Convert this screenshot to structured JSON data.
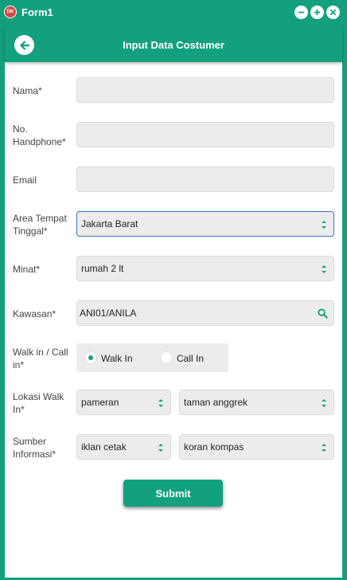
{
  "window": {
    "title": "Form1",
    "icon_text": "DK"
  },
  "header": {
    "title": "Input Data Costumer"
  },
  "form": {
    "nama": {
      "label": "Nama*",
      "value": ""
    },
    "handphone": {
      "label": "No. Handphone*",
      "value": ""
    },
    "email": {
      "label": "Email",
      "value": ""
    },
    "area": {
      "label": "Area Tempat Tinggal*",
      "value": "Jakarta Barat"
    },
    "minat": {
      "label": "Minat*",
      "value": "rumah 2 lt"
    },
    "kawasan": {
      "label": "Kawasan*",
      "value": "ANI01/ANILA"
    },
    "walkin_callin": {
      "label": "Walk in / Call in*",
      "options": [
        "Walk In",
        "Call In"
      ],
      "selected": "Walk In"
    },
    "lokasi": {
      "label": "Lokasi Walk In*",
      "value1": "pameran",
      "value2": "taman anggrek"
    },
    "sumber": {
      "label": "Sumber Informasi*",
      "value1": "iklan cetak",
      "value2": "koran kompas"
    },
    "submit_label": "Submit"
  },
  "colors": {
    "primary": "#13a07d",
    "field_bg": "#ececec",
    "focus_border": "#3b73c4"
  }
}
